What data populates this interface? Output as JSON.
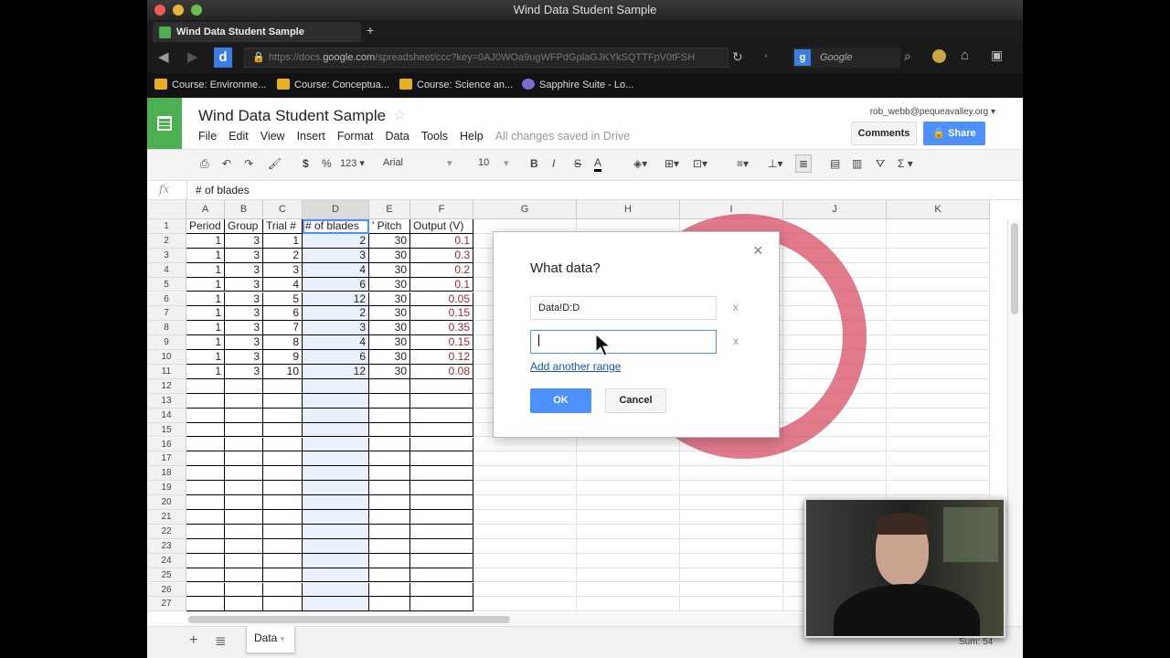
{
  "window": {
    "title": "Wind Data Student Sample"
  },
  "browser": {
    "tab_label": "Wind Data Student Sample",
    "new_tab": "+",
    "url_prefix": "https://docs.",
    "url_host": "google.com",
    "url_rest": "/spreadsheet/ccc?key=0AJ0WOa9ugWFPdGplaGJKYkSQTTFpV0tFSH",
    "search_placeholder": "Google",
    "bookmarks": [
      "Course: Environme...",
      "Course: Conceptua...",
      "Course: Science an...",
      "Sapphire Suite - Lo..."
    ]
  },
  "app": {
    "doc_title": "Wind Data Student Sample",
    "menu": [
      "File",
      "Edit",
      "View",
      "Insert",
      "Format",
      "Data",
      "Tools",
      "Help"
    ],
    "save_status": "All changes saved in Drive",
    "user_email": "rob_webb@pequeavalley.org",
    "comments_label": "Comments",
    "share_label": "Share",
    "accent": "#4d90fe"
  },
  "toolbar": {
    "currency": "$",
    "percent": "%",
    "number_format": "123",
    "font": "Arial",
    "font_size": "10",
    "bold": "B",
    "italic": "I",
    "strike": "S",
    "text_color": "A",
    "sum": "Σ"
  },
  "formula_bar": {
    "fx": "fx",
    "value": "# of blades"
  },
  "sheet": {
    "columns": [
      "A",
      "B",
      "C",
      "D",
      "E",
      "F",
      "G",
      "H",
      "I",
      "J",
      "K"
    ],
    "row_count": 27,
    "headers": [
      "Period",
      "Group",
      "Trial #",
      "# of blades",
      "' Pitch",
      "Output (V)"
    ],
    "rows": [
      [
        1,
        3,
        1,
        2,
        30,
        "0.1"
      ],
      [
        1,
        3,
        2,
        3,
        30,
        "0.3"
      ],
      [
        1,
        3,
        3,
        4,
        30,
        "0.2"
      ],
      [
        1,
        3,
        4,
        6,
        30,
        "0.1"
      ],
      [
        1,
        3,
        5,
        12,
        30,
        "0.05"
      ],
      [
        1,
        3,
        6,
        2,
        30,
        "0.15"
      ],
      [
        1,
        3,
        7,
        3,
        30,
        "0.35"
      ],
      [
        1,
        3,
        8,
        4,
        30,
        "0.15"
      ],
      [
        1,
        3,
        9,
        6,
        30,
        "0.12"
      ],
      [
        1,
        3,
        10,
        12,
        30,
        "0.08"
      ]
    ],
    "tab_name": "Data",
    "add_sheet": "+",
    "sum_status": "Sum: 54"
  },
  "dialog": {
    "title": "What data?",
    "range1": "Data!D:D",
    "range2": "",
    "remove": "x",
    "close": "×",
    "add_range": "Add another range",
    "ok": "OK",
    "cancel": "Cancel"
  }
}
